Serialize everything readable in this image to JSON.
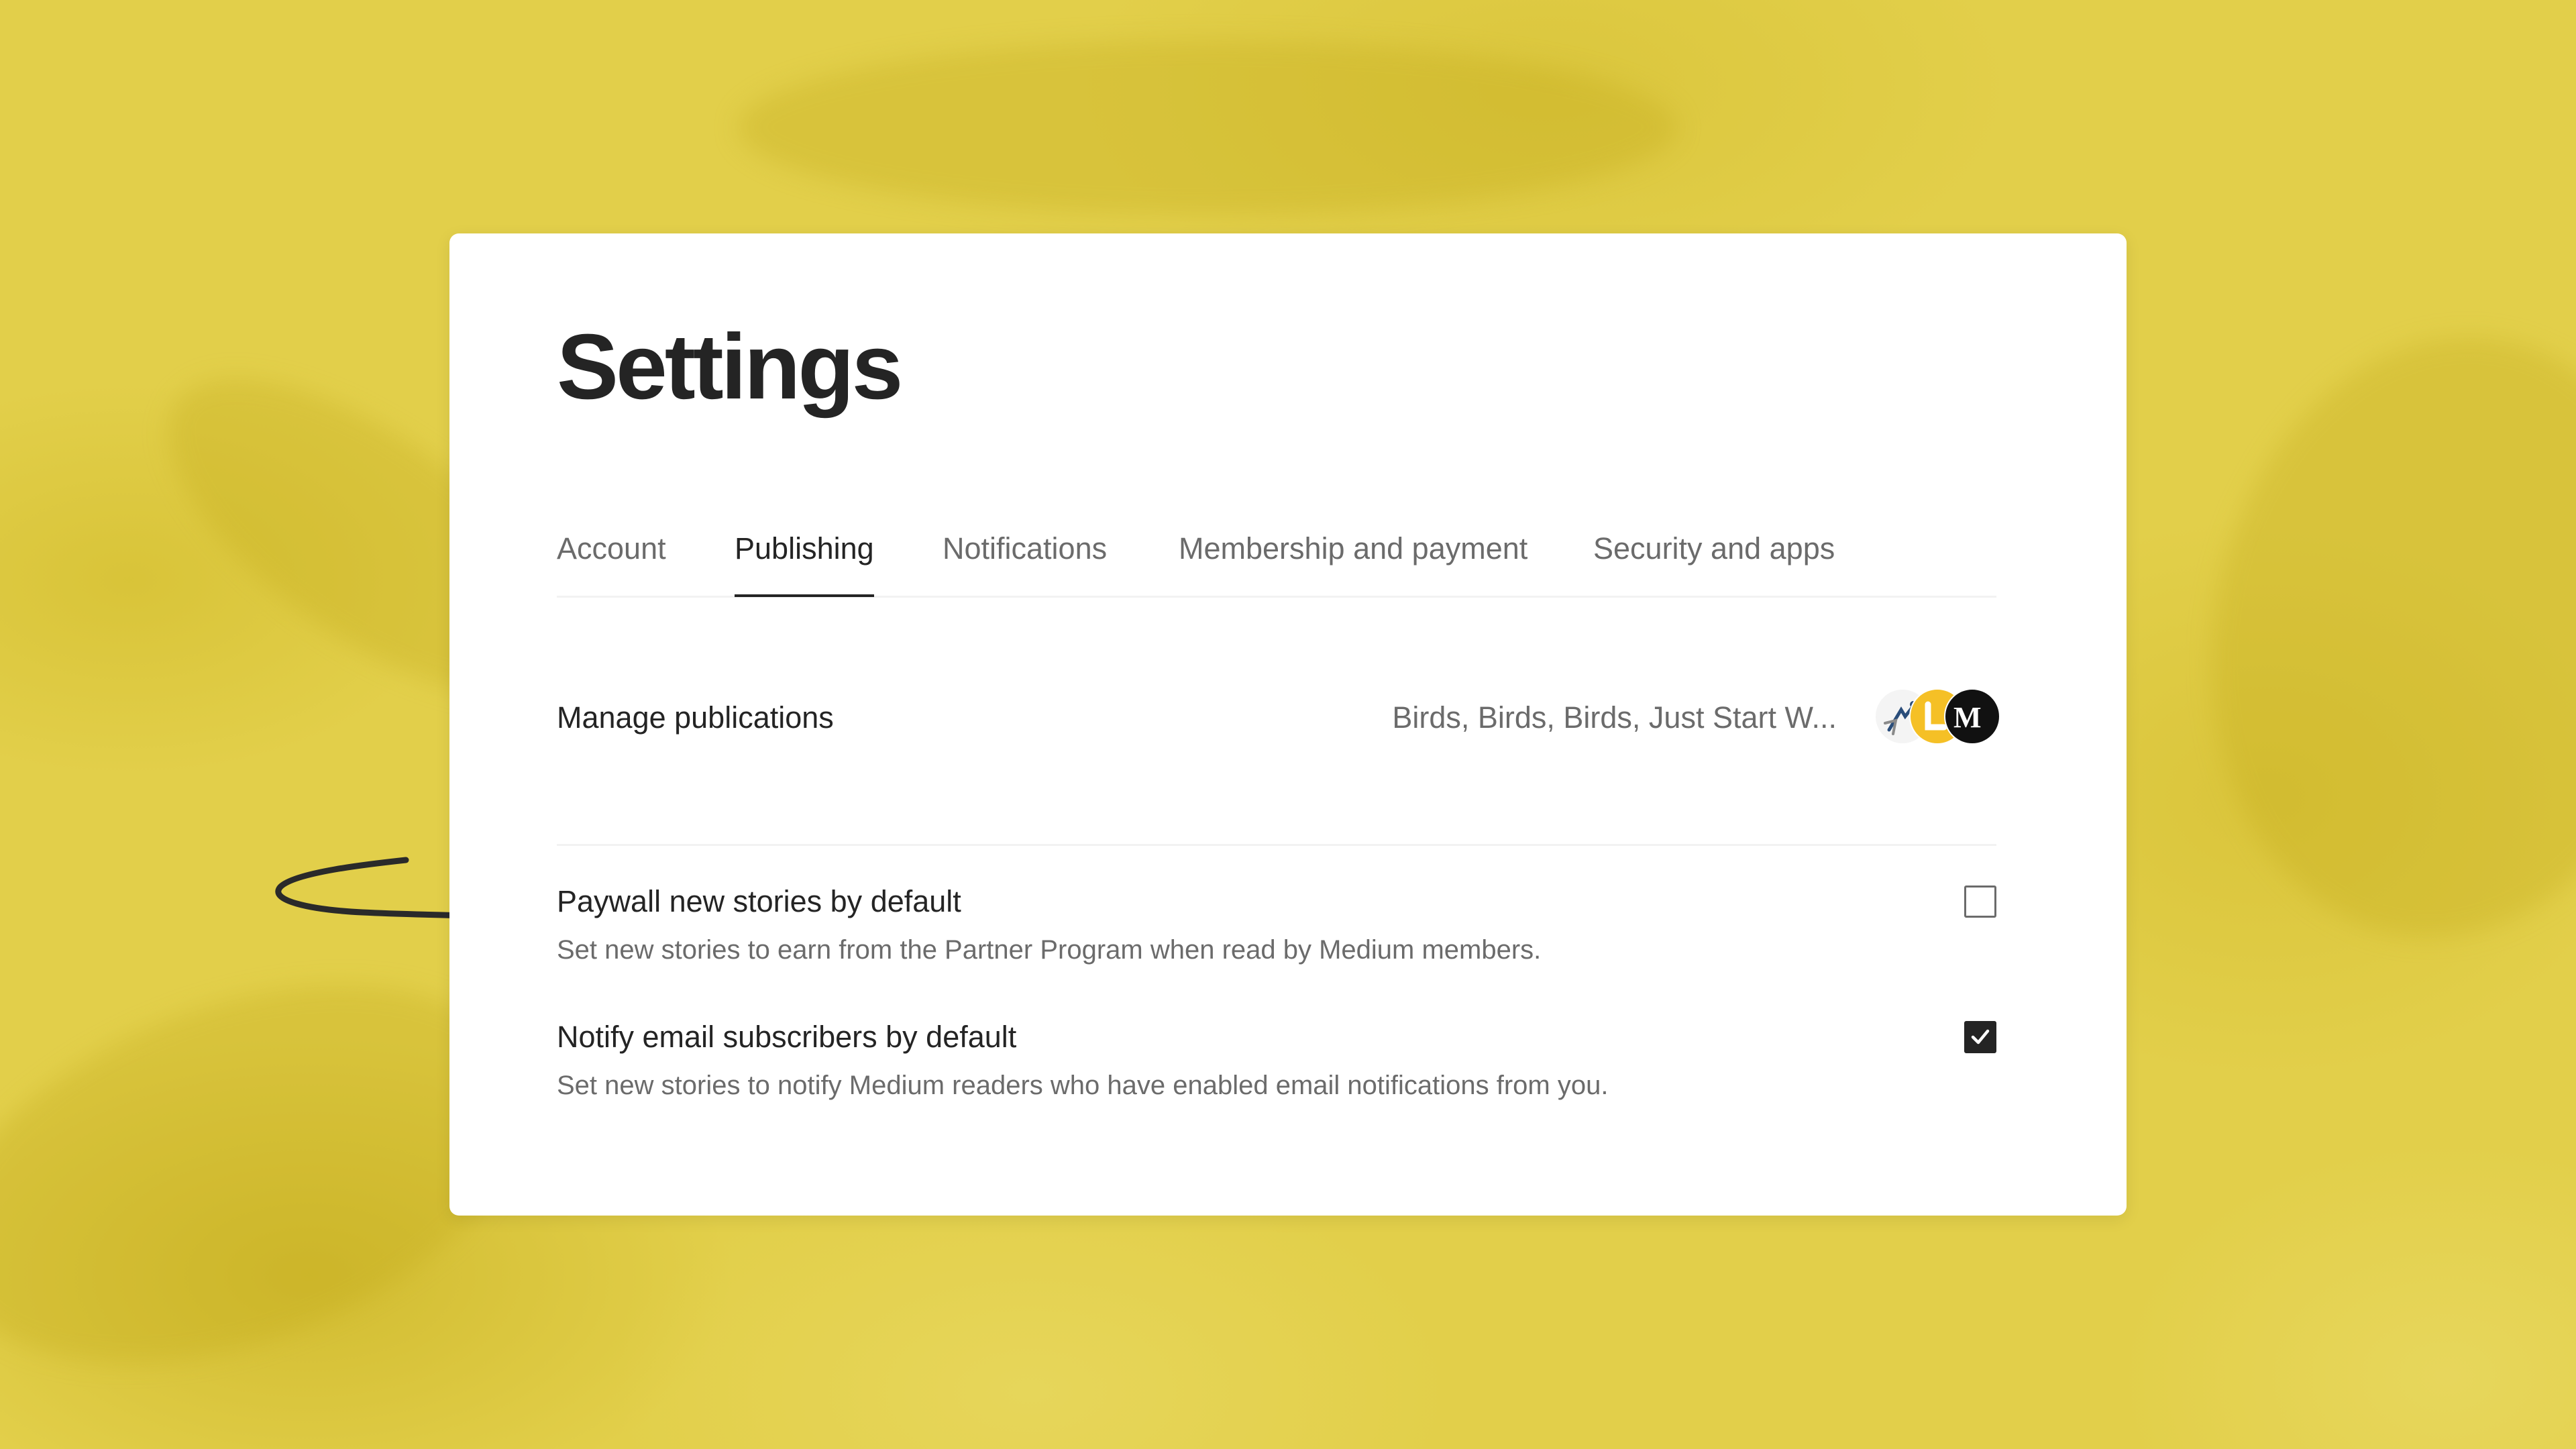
{
  "page": {
    "title": "Settings"
  },
  "tabs": [
    {
      "label": "Account",
      "active": false
    },
    {
      "label": "Publishing",
      "active": true
    },
    {
      "label": "Notifications",
      "active": false
    },
    {
      "label": "Membership and payment",
      "active": false
    },
    {
      "label": "Security and apps",
      "active": false
    }
  ],
  "manage_publications": {
    "label": "Manage publications",
    "value": "Birds, Birds, Birds, Just Start W...",
    "avatars": [
      "birds-publication-icon",
      "just-start-publication-icon",
      "medium-publication-icon"
    ]
  },
  "settings": [
    {
      "label": "Paywall new stories by default",
      "description": "Set new stories to earn from the Partner Program when read by Medium members.",
      "checked": false
    },
    {
      "label": "Notify email subscribers by default",
      "description": "Set new stories to notify Medium readers who have enabled email notifications from you.",
      "checked": true
    }
  ],
  "colors": {
    "background": "#e2ce45",
    "card": "#ffffff",
    "text_primary": "#242424",
    "text_secondary": "#6b6b6b",
    "divider": "#f2f2f2"
  }
}
